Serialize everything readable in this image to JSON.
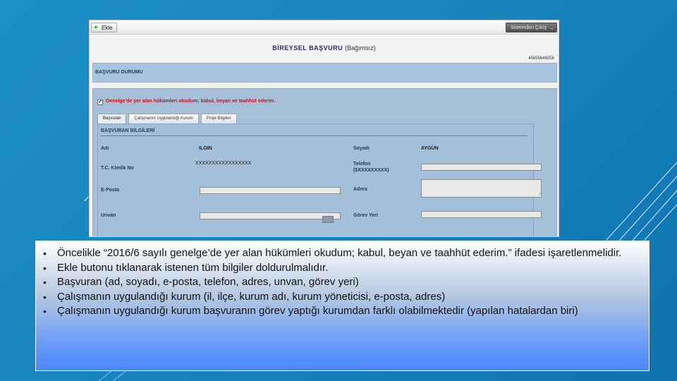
{
  "app": {
    "add_button": "Ekle",
    "logout_button": "Sistemden Çıkış",
    "title": "BİREYSEL BAŞVURU",
    "subtitle": "(Bağımsız)",
    "application_number": "45655646056",
    "status_bar": "BAŞVURU DURUMU",
    "declaration": "Genelge'de yer alan hükümleri okudum; kabul, beyan ve taahhüt ederim.",
    "declaration_checked": true,
    "tabs": [
      {
        "label": "Başvuran",
        "active": true
      },
      {
        "label": "Çalışmanın Uygulandığı Kurum",
        "active": false
      },
      {
        "label": "Proje Bilgileri",
        "active": false
      }
    ],
    "section_title": "BAŞVURAN BİLGİLERİ",
    "fields": {
      "ad_label": "Adı",
      "ad_value": "ILGIN",
      "soyad_label": "Soyadı",
      "soyad_value": "AYGÜN",
      "tc_label": "T.C. Kimlik No",
      "tc_value": "XXXXXXXXXXXXXXXXX",
      "telefon_label": "Telefon",
      "telefon_format": "(5XXXXXXXXX)",
      "eposta_label": "E-Posta",
      "adres_label": "Adres",
      "unvan_label": "Unvan",
      "gorev_label": "Görev Yeri"
    }
  },
  "instructions": [
    "Öncelikle “2016/6 sayılı genelge’de yer alan hükümleri okudum; kabul, beyan ve taahhüt ederim.” ifadesi işaretlenmelidir.",
    "Ekle butonu tıklanarak istenen tüm bilgiler doldurulmalıdır.",
    "Başvuran (ad, soyadı, e-posta, telefon, adres, unvan, görev yeri)",
    "Çalışmanın uygulandığı kurum (il, ilçe, kurum adı, kurum yöneticisi, e-posta, adres)",
    "Çalışmanın uygulandığı kurum başvuranın görev yaptığı kurumdan farklı olabilmektedir (yapılan hatalardan biri)"
  ],
  "colors": {
    "background": "#1682bd",
    "declaration_text": "#c3161c",
    "panel_blue": "#a6c0da"
  }
}
